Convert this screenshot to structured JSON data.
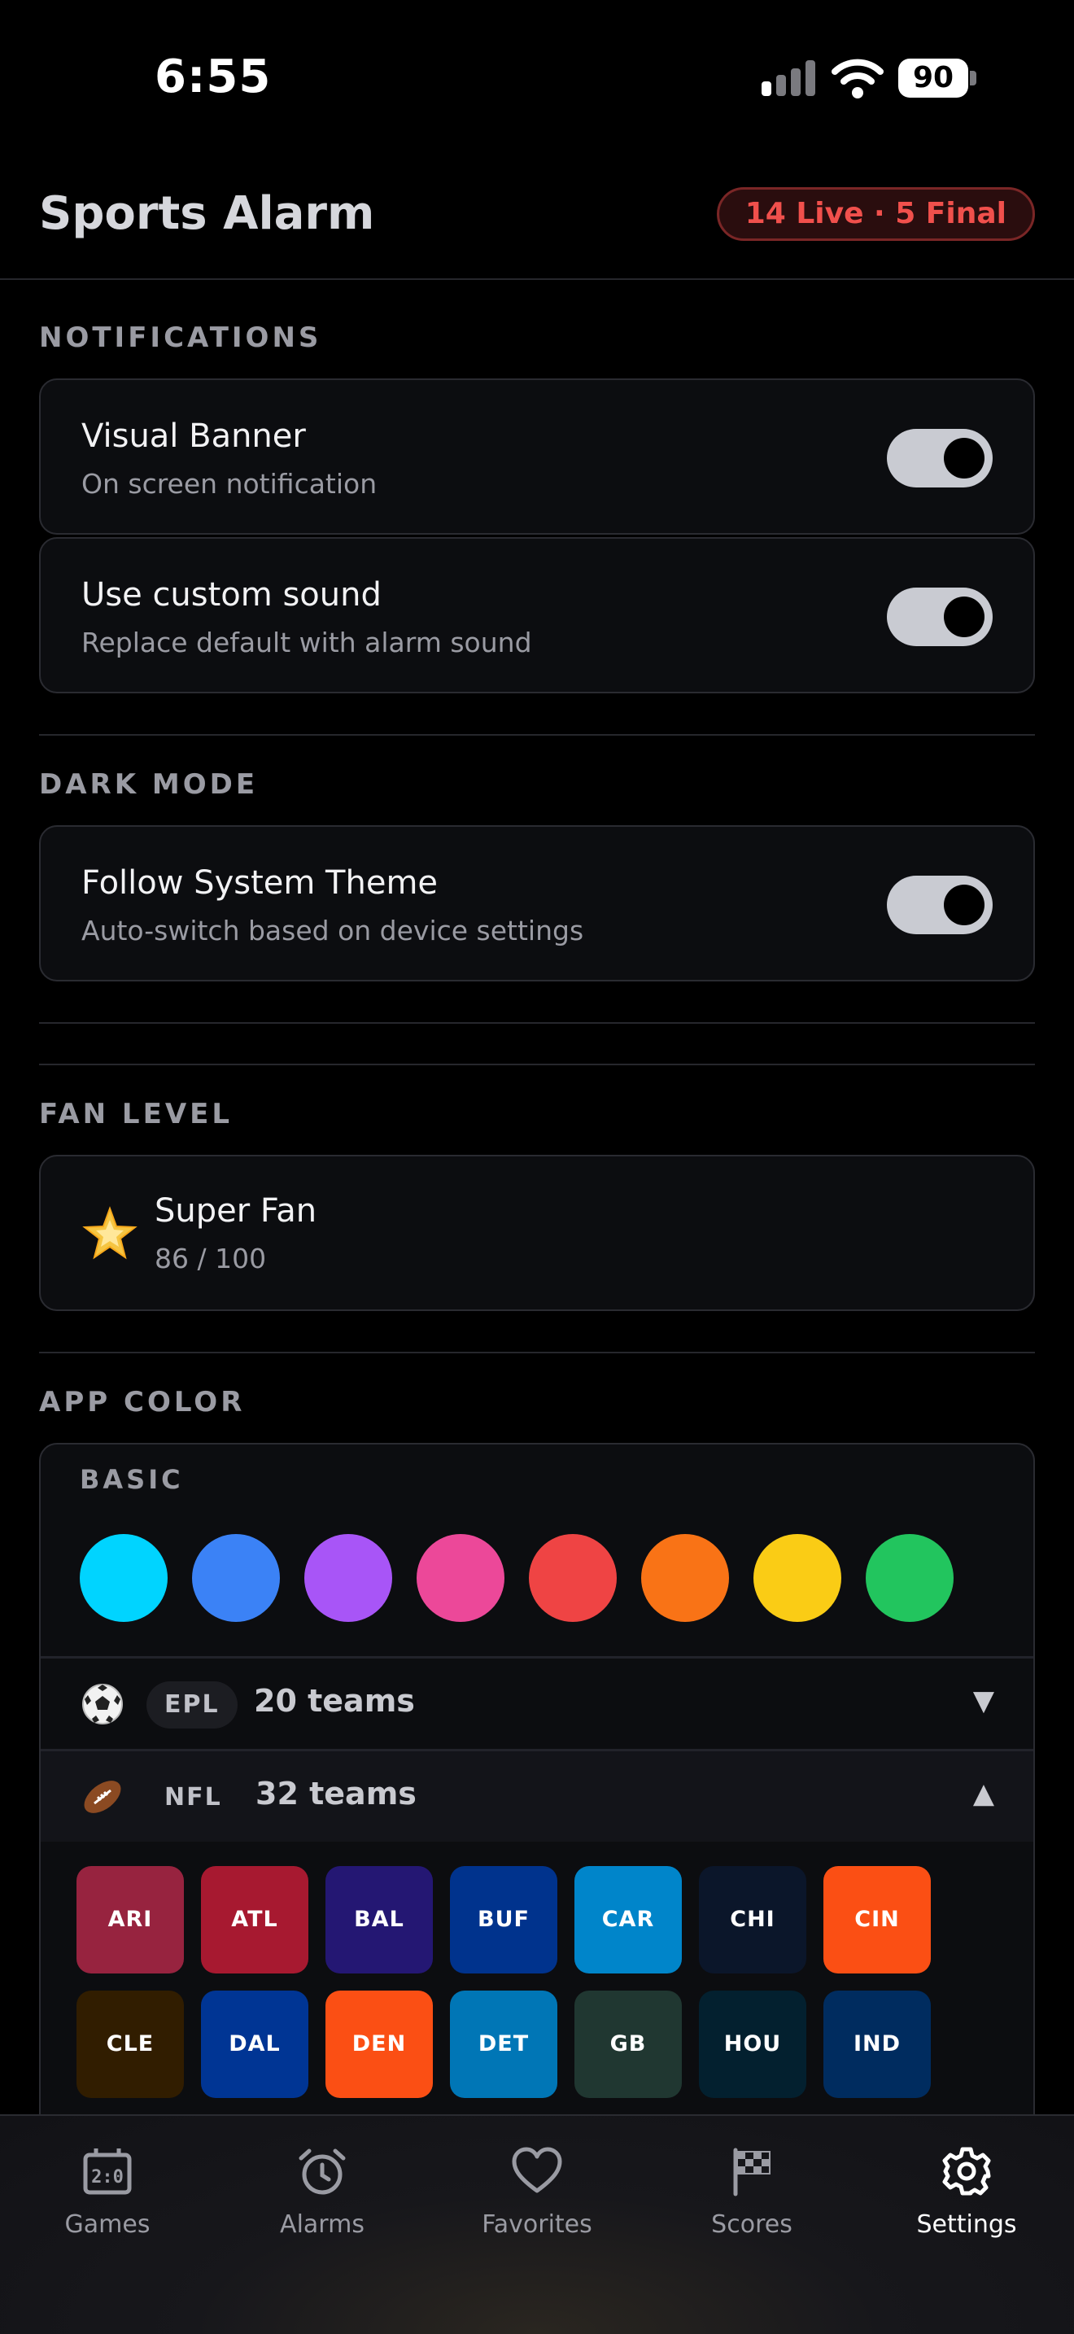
{
  "status_bar": {
    "time": "6:55",
    "battery": "90"
  },
  "header": {
    "title": "Sports Alarm",
    "badge": "14 Live · 5 Final"
  },
  "notifications": {
    "label": "NOTIFICATIONS",
    "rows": [
      {
        "title": "Visual Banner",
        "subtitle": "On screen notification",
        "on": true
      },
      {
        "title": "Use custom sound",
        "subtitle": "Replace default with alarm sound",
        "on": true
      }
    ]
  },
  "dark_mode": {
    "label": "DARK MODE",
    "row": {
      "title": "Follow System Theme",
      "subtitle": "Auto-switch based on device settings",
      "on": true
    }
  },
  "fan_level": {
    "label": "FAN LEVEL",
    "icon": "star-icon",
    "title": "Super Fan",
    "score": "86 / 100"
  },
  "app_color": {
    "label": "APP COLOR",
    "basic_label": "BASIC",
    "basic_colors": [
      "#00d4ff",
      "#3b82f6",
      "#a855f7",
      "#ec4899",
      "#ef4444",
      "#f97316",
      "#facc15",
      "#22c55e"
    ],
    "leagues": [
      {
        "icon": "soccer-ball-icon",
        "name": "EPL",
        "count": "20 teams",
        "arrow": "▼",
        "expanded": false
      },
      {
        "icon": "football-icon",
        "name": "NFL",
        "count": "32 teams",
        "arrow": "▲",
        "expanded": true
      }
    ],
    "nfl_teams": [
      {
        "abbr": "ARI",
        "color": "#97233f"
      },
      {
        "abbr": "ATL",
        "color": "#a71930"
      },
      {
        "abbr": "BAL",
        "color": "#241773"
      },
      {
        "abbr": "BUF",
        "color": "#00338d"
      },
      {
        "abbr": "CAR",
        "color": "#0085ca"
      },
      {
        "abbr": "CHI",
        "color": "#0b162a"
      },
      {
        "abbr": "CIN",
        "color": "#fb4f14"
      },
      {
        "abbr": "CLE",
        "color": "#311d00"
      },
      {
        "abbr": "DAL",
        "color": "#003594"
      },
      {
        "abbr": "DEN",
        "color": "#fb4f14"
      },
      {
        "abbr": "DET",
        "color": "#0076b6"
      },
      {
        "abbr": "GB",
        "color": "#203731"
      },
      {
        "abbr": "HOU",
        "color": "#03202f"
      },
      {
        "abbr": "IND",
        "color": "#002c5f"
      }
    ]
  },
  "tabs": [
    {
      "label": "Games",
      "icon": "scoreboard-icon",
      "active": false
    },
    {
      "label": "Alarms",
      "icon": "alarm-clock-icon",
      "active": false
    },
    {
      "label": "Favorites",
      "icon": "heart-icon",
      "active": false
    },
    {
      "label": "Scores",
      "icon": "checkered-flag-icon",
      "active": false
    },
    {
      "label": "Settings",
      "icon": "gear-icon",
      "active": true
    }
  ]
}
